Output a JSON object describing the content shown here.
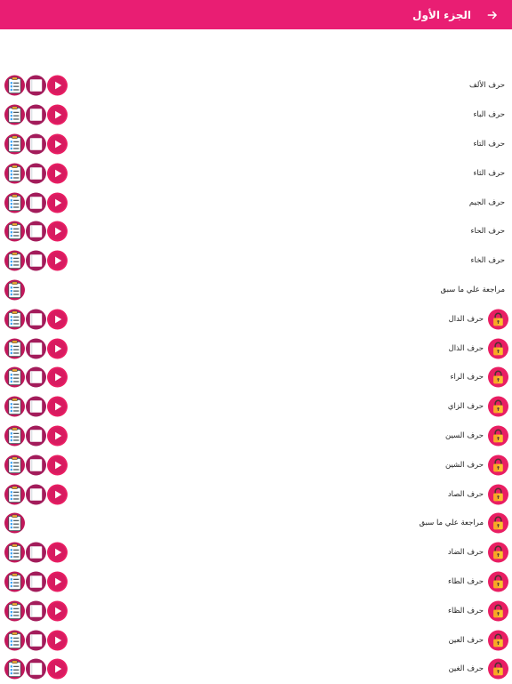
{
  "header": {
    "title": "الجزء الأول",
    "accent_color": "#e91e73",
    "back_icon": "arrow-right-icon"
  },
  "lessons": [
    {
      "label": "حرف الألف",
      "locked": false,
      "actions": [
        "quiz",
        "book",
        "play"
      ]
    },
    {
      "label": "حرف الباء",
      "locked": false,
      "actions": [
        "quiz",
        "book",
        "play"
      ]
    },
    {
      "label": "حرف التاء",
      "locked": false,
      "actions": [
        "quiz",
        "book",
        "play"
      ]
    },
    {
      "label": "حرف الثاء",
      "locked": false,
      "actions": [
        "quiz",
        "book",
        "play"
      ]
    },
    {
      "label": "حرف الجيم",
      "locked": false,
      "actions": [
        "quiz",
        "book",
        "play"
      ]
    },
    {
      "label": "حرف الحاء",
      "locked": false,
      "actions": [
        "quiz",
        "book",
        "play"
      ]
    },
    {
      "label": "حرف الخاء",
      "locked": false,
      "actions": [
        "quiz",
        "book",
        "play"
      ]
    },
    {
      "label": "مراجعة علي ما سبق",
      "locked": false,
      "actions": [
        "quiz"
      ]
    },
    {
      "label": "حرف الدال",
      "locked": true,
      "actions": [
        "quiz",
        "book",
        "play"
      ]
    },
    {
      "label": "حرف الذال",
      "locked": true,
      "actions": [
        "quiz",
        "book",
        "play"
      ]
    },
    {
      "label": "حرف الراء",
      "locked": true,
      "actions": [
        "quiz",
        "book",
        "play"
      ]
    },
    {
      "label": "حرف الزاي",
      "locked": true,
      "actions": [
        "quiz",
        "book",
        "play"
      ]
    },
    {
      "label": "حرف السين",
      "locked": true,
      "actions": [
        "quiz",
        "book",
        "play"
      ]
    },
    {
      "label": "حرف الشين",
      "locked": true,
      "actions": [
        "quiz",
        "book",
        "play"
      ]
    },
    {
      "label": "حرف الصاد",
      "locked": true,
      "actions": [
        "quiz",
        "book",
        "play"
      ]
    },
    {
      "label": "مراجعة علي ما سبق",
      "locked": true,
      "actions": [
        "quiz"
      ]
    },
    {
      "label": "حرف الضاد",
      "locked": true,
      "actions": [
        "quiz",
        "book",
        "play"
      ]
    },
    {
      "label": "حرف الطاء",
      "locked": true,
      "actions": [
        "quiz",
        "book",
        "play"
      ]
    },
    {
      "label": "حرف الظاء",
      "locked": true,
      "actions": [
        "quiz",
        "book",
        "play"
      ]
    },
    {
      "label": "حرف العين",
      "locked": true,
      "actions": [
        "quiz",
        "book",
        "play"
      ]
    },
    {
      "label": "حرف الغين",
      "locked": true,
      "actions": [
        "quiz",
        "book",
        "play"
      ]
    }
  ]
}
